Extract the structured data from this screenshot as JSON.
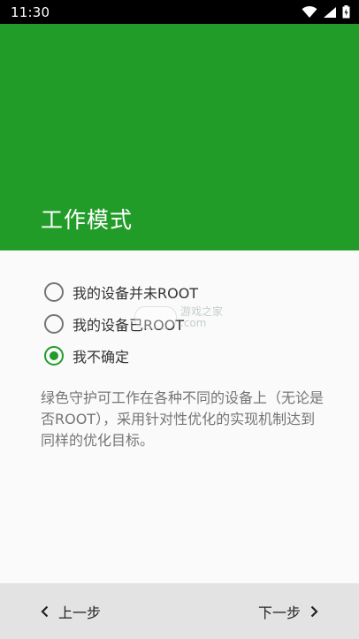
{
  "status_bar": {
    "time": "11:30"
  },
  "header": {
    "title": "工作模式"
  },
  "options": [
    {
      "label": "我的设备并未ROOT",
      "checked": false
    },
    {
      "label": "我的设备已ROOT",
      "checked": false
    },
    {
      "label": "我不确定",
      "checked": true
    }
  ],
  "description": "绿色守护可工作在各种不同的设备上（无论是否ROOT），采用针对性优化的实现机制达到同样的优化目标。",
  "watermark": {
    "line1": "游戏之家",
    "line2": ".com"
  },
  "footer": {
    "prev_label": "上一步",
    "next_label": "下一步"
  },
  "colors": {
    "accent": "#229c29",
    "footer_bg": "#e3e3e3"
  },
  "icons": {
    "wifi": "wifi-icon",
    "signal": "signal-icon",
    "battery": "battery-icon",
    "prev": "chevron-left-icon",
    "next": "chevron-right-icon"
  }
}
